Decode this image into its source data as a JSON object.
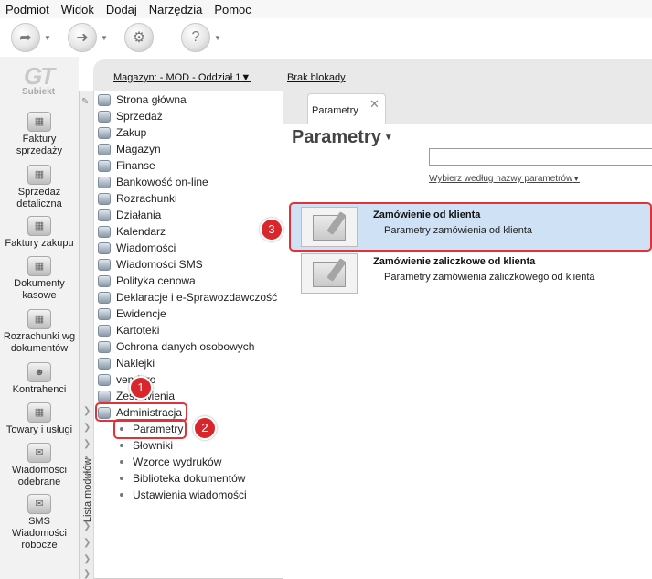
{
  "menu": [
    "Podmiot",
    "Widok",
    "Dodaj",
    "Narzędzia",
    "Pomoc"
  ],
  "toolbar_icons": [
    "back-icon",
    "forward-icon",
    "gear-icon",
    "help-icon"
  ],
  "logo": {
    "glyph": "GT",
    "name": "Subiekt"
  },
  "left_nav": [
    {
      "label": "Faktury sprzedaży",
      "icon": "invoices-icon"
    },
    {
      "label": "Sprzedaż detaliczna",
      "icon": "retail-icon"
    },
    {
      "label": "Faktury zakupu",
      "icon": "purchase-invoices-icon"
    },
    {
      "label": "Dokumenty kasowe",
      "icon": "cash-documents-icon"
    },
    {
      "label": "Rozrachunki wg dokumentów",
      "icon": "settlements-icon"
    },
    {
      "label": "Kontrahenci",
      "icon": "contractors-icon"
    },
    {
      "label": "Towary i usługi",
      "icon": "goods-icon"
    },
    {
      "label": "Wiadomości odebrane",
      "icon": "inbox-icon"
    },
    {
      "label": "SMS Wiadomości robocze",
      "icon": "sms-drafts-icon"
    }
  ],
  "address": {
    "warehouse": "Magazyn: - MOD - Oddział 1",
    "lock": "Brak blokady"
  },
  "module_panel_label": "Lista modułów",
  "modules": [
    "Strona główna",
    "Sprzedaż",
    "Zakup",
    "Magazyn",
    "Finanse",
    "Bankowość on-line",
    "Rozrachunki",
    "Działania",
    "Kalendarz",
    "Wiadomości",
    "Wiadomości SMS",
    "Polityka cenowa",
    "Deklaracje i e-Sprawozdawczość",
    "Ewidencje",
    "Kartoteki",
    "Ochrona danych osobowych",
    "Naklejki",
    "vendero",
    "Zestawienia",
    "Administracja"
  ],
  "submodules": [
    "Parametry",
    "Słowniki",
    "Wzorce wydruków",
    "Biblioteka dokumentów",
    "Ustawienia wiadomości"
  ],
  "tab": {
    "label": "Parametry",
    "close": "✕"
  },
  "page": {
    "title": "Parametry",
    "chooser": "Wybierz według nazwy parametrów",
    "items": [
      {
        "title": "Zamówienie od klienta",
        "subtitle": "Parametry zamówienia od klienta"
      },
      {
        "title": "Zamówienie zaliczkowe od klienta",
        "subtitle": "Parametry zamówienia zaliczkowego od klienta"
      }
    ]
  },
  "badges": [
    "1",
    "2",
    "3"
  ],
  "colors": {
    "annotation": "#d9262d",
    "selection": "#cfe2f5"
  }
}
